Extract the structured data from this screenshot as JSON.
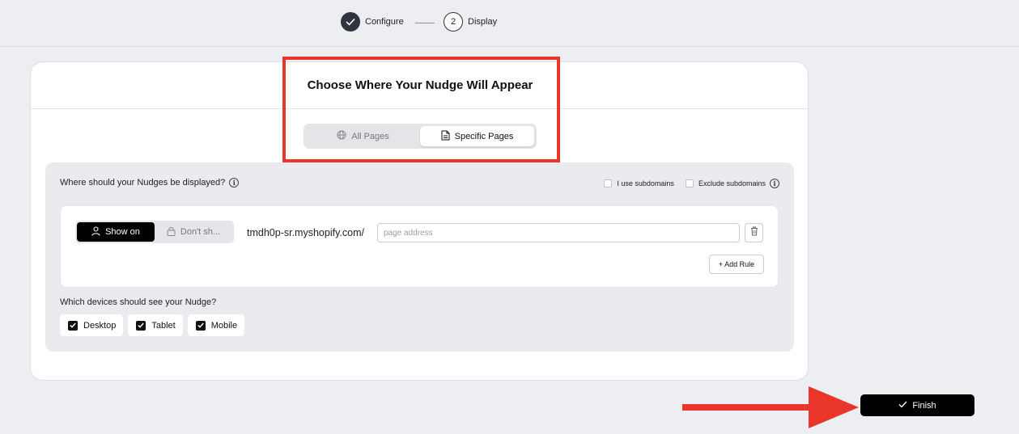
{
  "stepper": {
    "steps": [
      {
        "number": "",
        "label": "Configure",
        "status": "done"
      },
      {
        "number": "2",
        "label": "Display",
        "status": "current"
      }
    ]
  },
  "card": {
    "title": "Choose Where Your Nudge Will Appear",
    "page_scope": {
      "options": [
        "All Pages",
        "Specific Pages"
      ],
      "selected": "Specific Pages"
    }
  },
  "panel": {
    "question": "Where should your Nudges be displayed?",
    "use_subdomains_label": "I use subdomains",
    "exclude_subdomains_label": "Exclude subdomains",
    "rule": {
      "show_on_label": "Show on",
      "dont_show_label": "Don't sh...",
      "domain": "tmdh0p-sr.myshopify.com/",
      "page_address_value": "",
      "page_address_placeholder": "page address",
      "add_rule_label": "+ Add Rule"
    },
    "devices_question": "Which devices should see your Nudge?",
    "devices": [
      {
        "label": "Desktop",
        "checked": true
      },
      {
        "label": "Tablet",
        "checked": true
      },
      {
        "label": "Mobile",
        "checked": true
      }
    ]
  },
  "footer": {
    "finish_label": "Finish"
  },
  "colors": {
    "annotation_red": "#e8362b",
    "primary_black": "#000000",
    "step_done": "#2f3441"
  }
}
